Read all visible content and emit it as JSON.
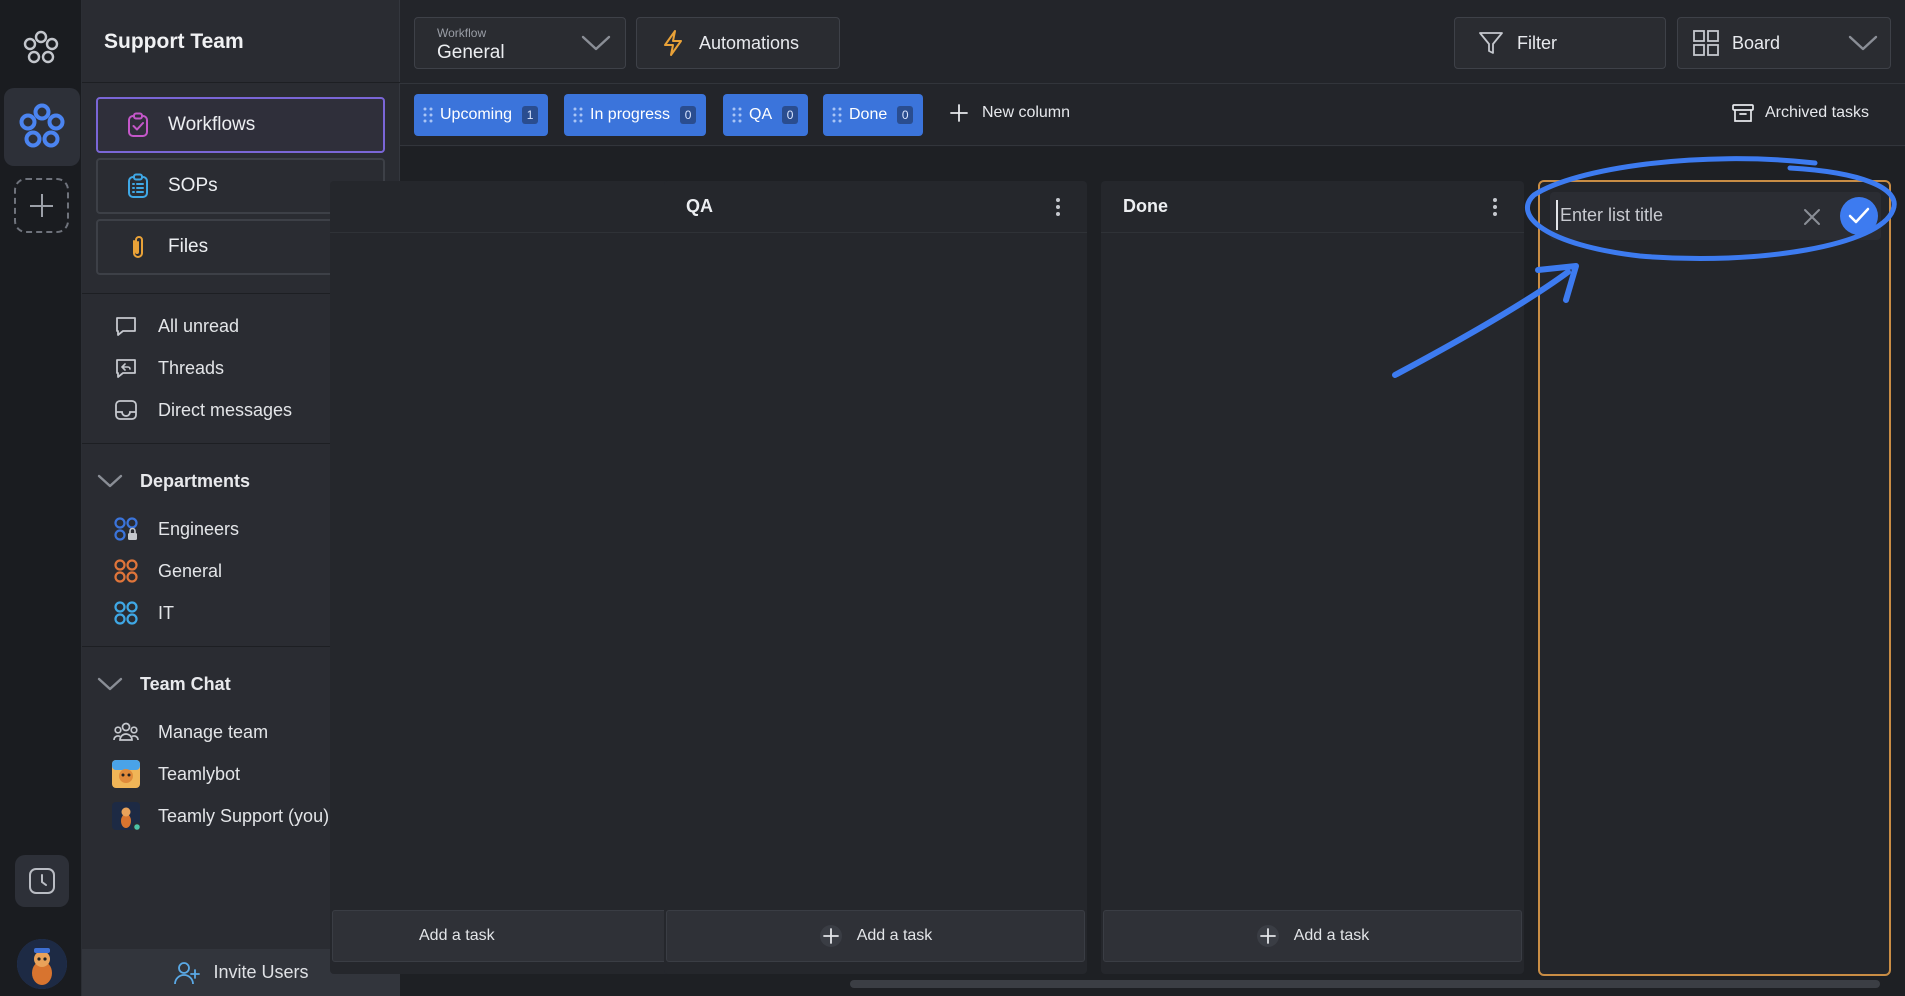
{
  "rail": {
    "logo_icon": "flower-logo-icon",
    "workspace_icon": "flower-workspace-icon",
    "add_icon": "plus-icon",
    "clock_icon": "clock-icon"
  },
  "sidebar": {
    "title": "Support Team",
    "nav": [
      {
        "label": "Workflows",
        "icon": "clipboard-check-icon",
        "active": true
      },
      {
        "label": "SOPs",
        "icon": "clipboard-list-icon"
      },
      {
        "label": "Files",
        "icon": "paperclip-icon"
      }
    ],
    "inbox": [
      {
        "label": "All unread",
        "icon": "chat-bubble-icon"
      },
      {
        "label": "Threads",
        "icon": "reply-bubble-icon"
      },
      {
        "label": "Direct messages",
        "icon": "inbox-icon"
      }
    ],
    "departments": {
      "label": "Departments",
      "items": [
        {
          "label": "Engineers",
          "icon": "group-lock-icon",
          "color": "#3b74db"
        },
        {
          "label": "General",
          "icon": "group-icon",
          "color": "#e0753a"
        },
        {
          "label": "IT",
          "icon": "group-icon",
          "color": "#3fa8e6"
        }
      ]
    },
    "team_chat": {
      "label": "Team Chat",
      "items": [
        {
          "label": "Manage team",
          "icon": "people-icon"
        },
        {
          "label": "Teamlybot",
          "icon": "bot-avatar"
        },
        {
          "label": "Teamly Support (you)",
          "icon": "user-avatar"
        }
      ]
    },
    "invite": "Invite Users"
  },
  "toolbar": {
    "workflow_caption": "Workflow",
    "workflow_value": "General",
    "automations": "Automations",
    "filter": "Filter",
    "view": "Board"
  },
  "columns_bar": {
    "chips": [
      {
        "label": "Upcoming",
        "count": "1"
      },
      {
        "label": "In progress",
        "count": "0"
      },
      {
        "label": "QA",
        "count": "0"
      },
      {
        "label": "Done",
        "count": "0"
      }
    ],
    "new_column": "New column",
    "archived": "Archived tasks"
  },
  "board": {
    "columns": [
      {
        "title": "",
        "add": "Add a task"
      },
      {
        "title": "QA",
        "add": "Add a task"
      },
      {
        "title": "Done",
        "add": "Add a task"
      }
    ],
    "new_list_placeholder": "Enter list title"
  },
  "colors": {
    "accent": "#3b74db",
    "active_border": "#7a66d6",
    "new_list_border": "#c98d45",
    "annotation": "#3d7bf0"
  }
}
